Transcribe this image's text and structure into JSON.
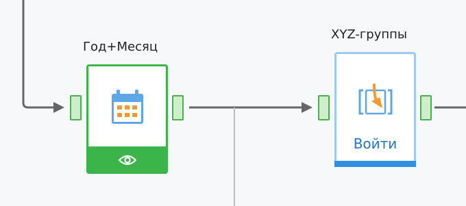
{
  "canvas": {
    "background": "#f6f8fa"
  },
  "nodes": {
    "date_node": {
      "title": "Год+Месяц",
      "icon": "calendar-icon",
      "footer_icon": "eye-icon",
      "accent_color": "#3bb54a"
    },
    "xyz_node": {
      "title": "XYZ-группы",
      "icon": "login-icon",
      "label": "Войти",
      "accent_color": "#2f8fe0"
    }
  },
  "colors": {
    "wire": "#666666",
    "port_fill": "#cdeec9",
    "port_border": "#48b04f",
    "icon_blue": "#5fa6e6",
    "icon_orange": "#f39a2b"
  }
}
